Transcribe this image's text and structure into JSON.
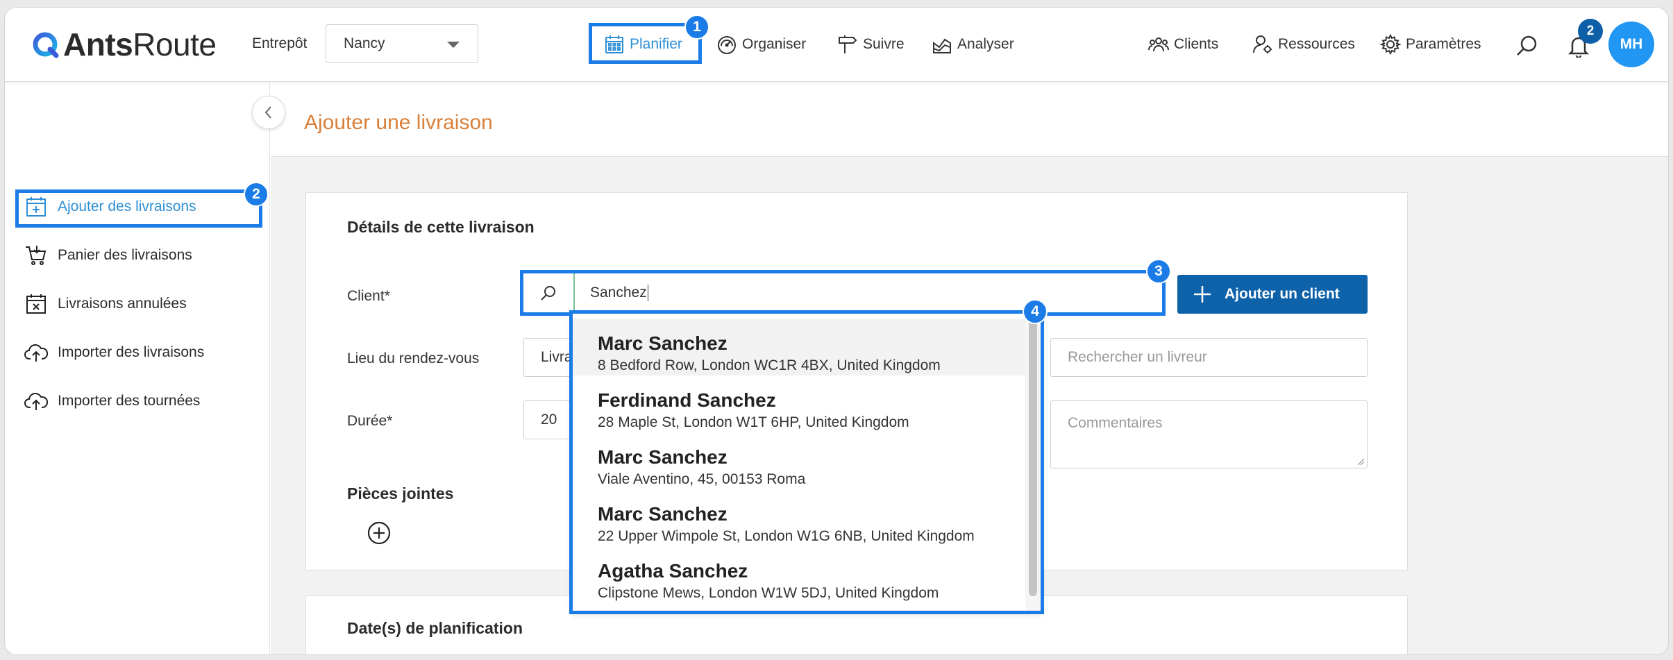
{
  "app": {
    "logo_bold": "Ants",
    "logo_light": "Route"
  },
  "topbar": {
    "entrepot_label": "Entrepôt",
    "entrepot_value": "Nancy",
    "nav": [
      {
        "label": "Planifier",
        "icon": "calendar-icon"
      },
      {
        "label": "Organiser",
        "icon": "gauge-icon"
      },
      {
        "label": "Suivre",
        "icon": "signpost-icon"
      },
      {
        "label": "Analyser",
        "icon": "chart-icon"
      },
      {
        "label": "Clients",
        "icon": "users-icon"
      },
      {
        "label": "Ressources",
        "icon": "user-gear-icon"
      },
      {
        "label": "Paramètres",
        "icon": "gear-icon"
      }
    ],
    "notification_count": "2",
    "avatar_initials": "MH"
  },
  "annotations": {
    "step1": "1",
    "step2": "2",
    "step3": "3",
    "step4": "4",
    "highlight_color": "#1b7ce8"
  },
  "sidebar": {
    "items": [
      {
        "label": "Ajouter des livraisons",
        "icon": "calendar-plus-icon"
      },
      {
        "label": "Panier des livraisons",
        "icon": "cart-icon"
      },
      {
        "label": "Livraisons annulées",
        "icon": "calendar-x-icon"
      },
      {
        "label": "Importer des livraisons",
        "icon": "cloud-upload-icon"
      },
      {
        "label": "Importer des tournées",
        "icon": "cloud-upload-icon"
      }
    ]
  },
  "main": {
    "page_title": "Ajouter une livraison",
    "details_card": {
      "title": "Détails de cette livraison",
      "client_label": "Client*",
      "client_search_value": "Sanchez",
      "add_client_label": "Ajouter un client",
      "lieu_label": "Lieu du rendez-vous",
      "lieu_value_partial": "Livra",
      "livreur_placeholder": "Rechercher un livreur",
      "duree_label": "Durée*",
      "duree_value": "20",
      "commentaires_placeholder": "Commentaires",
      "pieces_jointes_label": "Pièces jointes"
    },
    "planning_card": {
      "title": "Date(s) de planification"
    },
    "client_suggestions": [
      {
        "name": "Marc Sanchez",
        "address": "8 Bedford Row, London WC1R 4BX, United Kingdom"
      },
      {
        "name": "Ferdinand Sanchez",
        "address": "28 Maple St, London W1T 6HP, United Kingdom"
      },
      {
        "name": "Marc Sanchez",
        "address": "Viale Aventino, 45, 00153 Roma"
      },
      {
        "name": "Marc Sanchez",
        "address": "22 Upper Wimpole St, London W1G 6NB, United Kingdom"
      },
      {
        "name": "Agatha Sanchez",
        "address": "Clipstone Mews, London W1W 5DJ, United Kingdom"
      }
    ]
  }
}
